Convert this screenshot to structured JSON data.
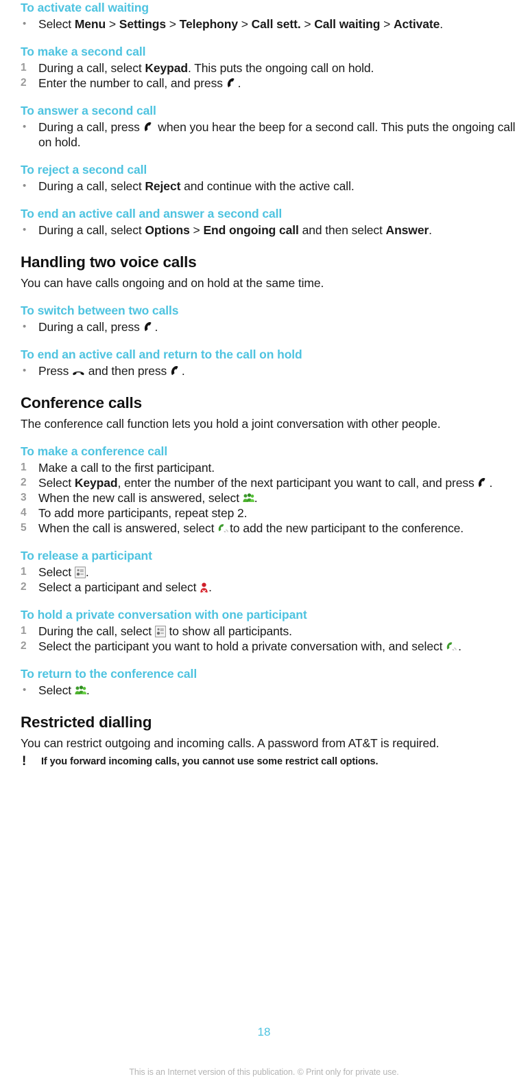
{
  "accent_color": "#4ec3e0",
  "text_color": "#1a1a1a",
  "sections": {
    "activate_call_waiting": {
      "heading": "To activate call waiting",
      "step1_a": "Select ",
      "step1_menu": "Menu",
      "step1_settings": "Settings",
      "step1_telephony": "Telephony",
      "step1_callsett": "Call sett.",
      "step1_callwaiting": "Call waiting",
      "step1_activate": "Activate",
      "step1_end": "."
    },
    "make_second_call": {
      "heading": "To make a second call",
      "step1_a": "During a call, select ",
      "step1_keypad": "Keypad",
      "step1_b": ". This puts the ongoing call on hold.",
      "step2_a": "Enter the number to call, and press ",
      "step2_b": "."
    },
    "answer_second_call": {
      "heading": "To answer a second call",
      "text_a": "During a call, press ",
      "text_b": " when you hear the beep for a second call. This puts the ongoing call on hold."
    },
    "reject_second_call": {
      "heading": "To reject a second call",
      "text_a": "During a call, select ",
      "text_reject": "Reject",
      "text_b": " and continue with the active call."
    },
    "end_active_answer_second": {
      "heading": "To end an active call and answer a second call",
      "text_a": "During a call, select ",
      "text_options": "Options",
      "text_endongoing": "End ongoing call",
      "text_b": " and then select ",
      "text_answer": "Answer",
      "text_c": "."
    },
    "handling_two_voice_calls": {
      "heading": "Handling two voice calls",
      "intro": "You can have calls ongoing and on hold at the same time."
    },
    "switch_between_two_calls": {
      "heading": "To switch between two calls",
      "text_a": "During a call, press ",
      "text_b": "."
    },
    "end_active_return_hold": {
      "heading": "To end an active call and return to the call on hold",
      "text_a": "Press ",
      "text_b": " and then press ",
      "text_c": "."
    },
    "conference_calls": {
      "heading": "Conference calls",
      "intro": "The conference call function lets you hold a joint conversation with other people."
    },
    "make_conference_call": {
      "heading": "To make a conference call",
      "step1": "Make a call to the first participant.",
      "step2_a": "Select ",
      "step2_keypad": "Keypad",
      "step2_b": ", enter the number of the next participant you want to call, and press ",
      "step2_c": ".",
      "step3_a": "When the new call is answered, select ",
      "step3_b": ".",
      "step4": "To add more participants, repeat step 2.",
      "step5_a": "When the call is answered, select ",
      "step5_b": "to add the new participant to the conference."
    },
    "release_participant": {
      "heading": "To release a participant",
      "step1_a": "Select ",
      "step1_b": ".",
      "step2_a": "Select a participant and select ",
      "step2_b": "."
    },
    "private_conversation": {
      "heading": "To hold a private conversation with one participant",
      "step1_a": "During the call, select ",
      "step1_b": " to show all participants.",
      "step2_a": "Select the participant you want to hold a private conversation with, and select ",
      "step2_b": "."
    },
    "return_to_conference": {
      "heading": "To return to the conference call",
      "text_a": "Select ",
      "text_b": "."
    },
    "restricted_dialling": {
      "heading": "Restricted dialling",
      "intro": "You can restrict outgoing and incoming calls. A password from AT&T is required.",
      "note_marker": "!",
      "note": "If you forward incoming calls, you cannot use some restrict call options."
    }
  },
  "markers": {
    "bullet": "•",
    "gt": ">",
    "one": "1",
    "two": "2",
    "three": "3",
    "four": "4",
    "five": "5"
  },
  "footer": {
    "page_number": "18",
    "copyright": "This is an Internet version of this publication. © Print only for private use."
  }
}
